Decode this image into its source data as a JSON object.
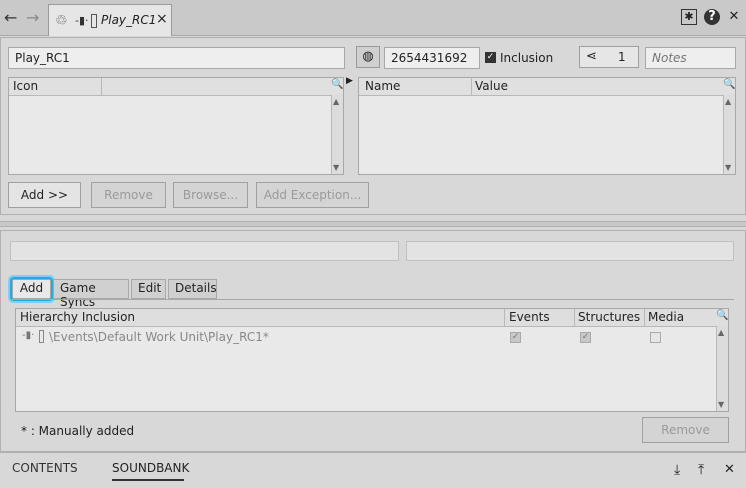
{
  "tab": {
    "title": "Play_RC1",
    "close": "×"
  },
  "nav": {
    "back": "←",
    "forward": "→"
  },
  "title_icons": {
    "pin": "✱",
    "help": "?",
    "close": "✕"
  },
  "header": {
    "name_value": "Play_RC1",
    "id_value": "2654431692",
    "inclusion_label": "Inclusion",
    "share_count": "1",
    "notes_placeholder": "Notes"
  },
  "left_list": {
    "col1": "Icon"
  },
  "right_list": {
    "col1": "Name",
    "col2": "Value"
  },
  "buttons_top": {
    "add": "Add >>",
    "remove": "Remove",
    "browse": "Browse...",
    "add_exception": "Add Exception..."
  },
  "tabs": [
    "Add",
    "Game Syncs",
    "Edit",
    "Details"
  ],
  "hierarchy": {
    "headers": [
      "Hierarchy Inclusion",
      "Events",
      "Structures",
      "Media"
    ],
    "rows": [
      {
        "path": "\\Events\\Default Work Unit\\Play_RC1*"
      }
    ]
  },
  "footnote": "* : Manually added",
  "remove_button": "Remove",
  "bottom_tabs": {
    "contents": "CONTENTS",
    "soundbank": "SOUNDBANK"
  },
  "bottom_icons": {
    "down": "⤓",
    "up": "⤒",
    "close": "✕"
  }
}
